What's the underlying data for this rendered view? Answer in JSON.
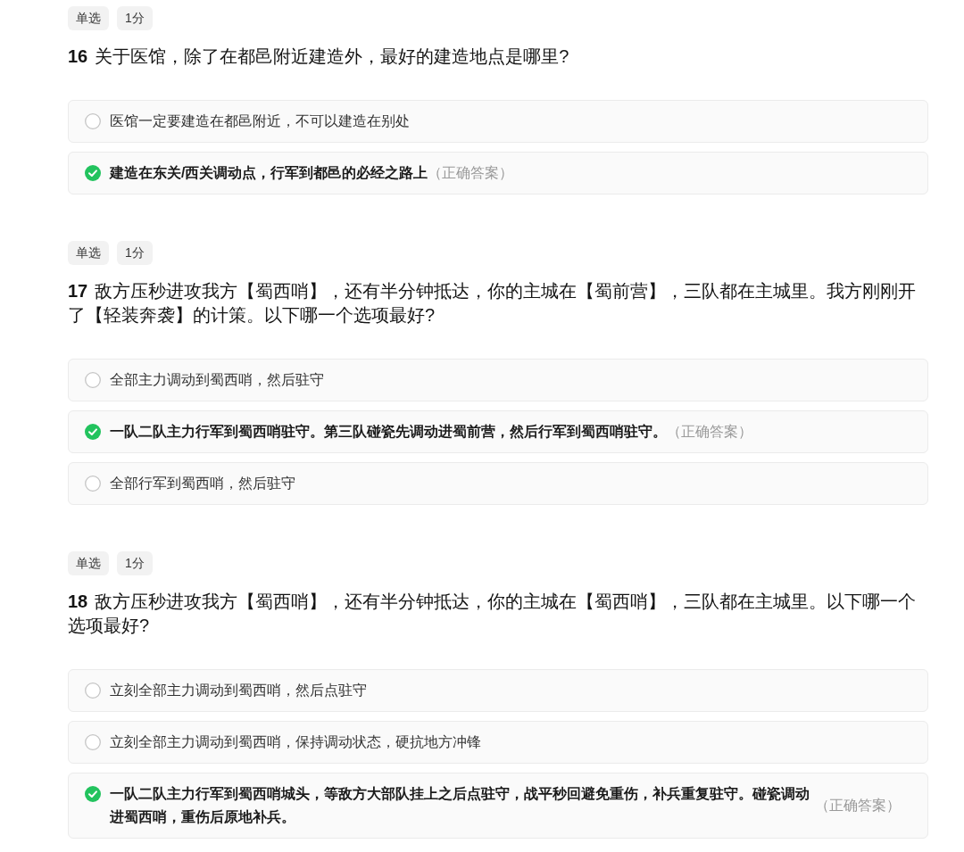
{
  "questions": [
    {
      "tags": [
        "单选",
        "1分"
      ],
      "number": "16",
      "text": "关于医馆，除了在都邑附近建造外，最好的建造地点是哪里?",
      "options": [
        {
          "text": "医馆一定要建造在都邑附近，不可以建造在别处",
          "selected": false
        },
        {
          "text": "建造在东关/西关调动点，行军到都邑的必经之路上",
          "selected": true,
          "note": "（正确答案）"
        }
      ]
    },
    {
      "tags": [
        "单选",
        "1分"
      ],
      "number": "17",
      "text": "敌方压秒进攻我方【蜀西哨】，还有半分钟抵达，你的主城在【蜀前营】，三队都在主城里。我方刚刚开了【轻装奔袭】的计策。以下哪一个选项最好?",
      "options": [
        {
          "text": "全部主力调动到蜀西哨，然后驻守",
          "selected": false
        },
        {
          "text": "一队二队主力行军到蜀西哨驻守。第三队碰瓷先调动进蜀前营，然后行军到蜀西哨驻守。",
          "selected": true,
          "note": "（正确答案）"
        },
        {
          "text": "全部行军到蜀西哨，然后驻守",
          "selected": false
        }
      ]
    },
    {
      "tags": [
        "单选",
        "1分"
      ],
      "number": "18",
      "text": "敌方压秒进攻我方【蜀西哨】，还有半分钟抵达，你的主城在【蜀西哨】，三队都在主城里。以下哪一个选项最好?",
      "options": [
        {
          "text": "立刻全部主力调动到蜀西哨，然后点驻守",
          "selected": false
        },
        {
          "text": "立刻全部主力调动到蜀西哨，保持调动状态，硬抗地方冲锋",
          "selected": false
        },
        {
          "text": "一队二队主力行军到蜀西哨城头，等敌方大部队挂上之后点驻守，战平秒回避免重伤，补兵重复驻守。碰瓷调动进蜀西哨，重伤后原地补兵。",
          "selected": true,
          "note": "（正确答案）"
        }
      ]
    }
  ]
}
